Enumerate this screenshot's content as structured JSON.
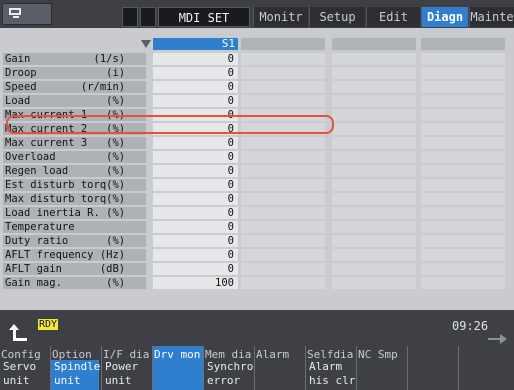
{
  "topbar": {
    "mode": "MDI SET",
    "tabs": [
      {
        "label": "Monitr"
      },
      {
        "label": "Setup"
      },
      {
        "label": "Edit"
      },
      {
        "label": "Diagn"
      },
      {
        "label": "Mainte"
      }
    ]
  },
  "table": {
    "header": "S1",
    "rows": [
      {
        "label": "Gain          (1/s)",
        "value": "0"
      },
      {
        "label": "Droop           (i)",
        "value": "0"
      },
      {
        "label": "Speed       (r/min)",
        "value": "0"
      },
      {
        "label": "Load            (%)",
        "value": "0"
      },
      {
        "label": "Max current 1   (%)",
        "value": "0"
      },
      {
        "label": "Max current 2   (%)",
        "value": "0"
      },
      {
        "label": "Max current 3   (%)",
        "value": "0"
      },
      {
        "label": "Overload        (%)",
        "value": "0"
      },
      {
        "label": "Regen load      (%)",
        "value": "0"
      },
      {
        "label": "Est disturb torq(%)",
        "value": "0"
      },
      {
        "label": "Max disturb torq(%)",
        "value": "0"
      },
      {
        "label": "Load inertia R. (%)",
        "value": "0"
      },
      {
        "label": "Temperature",
        "value": "0"
      },
      {
        "label": "Duty ratio      (%)",
        "value": "0"
      },
      {
        "label": "AFLT frequency (Hz)",
        "value": "0"
      },
      {
        "label": "AFLT gain      (dB)",
        "value": "0"
      },
      {
        "label": "Gain mag.       (%)",
        "value": "100"
      }
    ]
  },
  "status": {
    "ready": "RDY",
    "time": "09:26"
  },
  "fkeys": [
    {
      "top": "Config",
      "bottom": "Servo\nunit"
    },
    {
      "top": "Option",
      "bottom": "Spindle\nunit"
    },
    {
      "top": "I/F dia",
      "bottom": "Power\nunit"
    },
    {
      "top": "Drv mon",
      "bottom": ""
    },
    {
      "top": "Mem dia",
      "bottom": "Synchro\nerror"
    },
    {
      "top": "Alarm",
      "bottom": ""
    },
    {
      "top": "Selfdia",
      "bottom": "Alarm\nhis clr"
    },
    {
      "top": "NC Smp",
      "bottom": ""
    },
    {
      "top": "",
      "bottom": ""
    },
    {
      "top": "",
      "bottom": ""
    }
  ],
  "colors": {
    "accent": "#2f7fd0",
    "highlight": "#e5523a",
    "ready_bg": "#f2e93a"
  }
}
